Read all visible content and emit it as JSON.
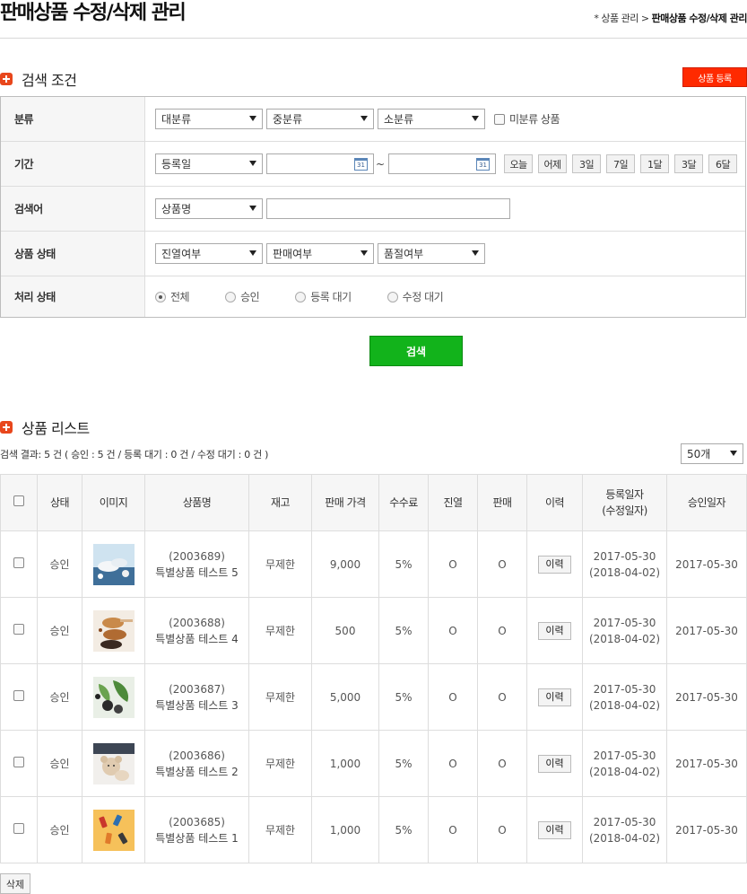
{
  "header": {
    "title": "판매상품 수정/삭제 관리",
    "breadcrumb_prefix": "* 상품 관리 >",
    "breadcrumb_current": "판매상품 수정/삭제 관리"
  },
  "search": {
    "section_title": "검색 조건",
    "register_button": "상품 등록",
    "category": {
      "label": "분류",
      "large": "대분류",
      "medium": "중분류",
      "small": "소분류",
      "uncategorized_label": "미분류 상품"
    },
    "period": {
      "label": "기간",
      "type": "등록일",
      "start_value": "",
      "end_value": "",
      "calendar_icon": "calendar-icon",
      "calendar_text": "31",
      "tilde": "~",
      "quick_buttons": [
        "오늘",
        "어제",
        "3일",
        "7일",
        "1달",
        "3달",
        "6달"
      ]
    },
    "keyword": {
      "label": "검색어",
      "type": "상품명",
      "value": ""
    },
    "product_status": {
      "label": "상품 상태",
      "display": "진열여부",
      "sale": "판매여부",
      "soldout": "품절여부"
    },
    "process_status": {
      "label": "처리 상태",
      "options": [
        "전체",
        "승인",
        "등록 대기",
        "수정 대기"
      ],
      "selected": "전체"
    },
    "search_button": "검색"
  },
  "list": {
    "section_title": "상품 리스트",
    "summary": "검색 결과: 5 건 ( 승인 : 5 건 / 등록 대기 : 0 건 / 수정 대기 : 0 건 )",
    "page_size": "50개",
    "headers": {
      "status": "상태",
      "image": "이미지",
      "name": "상품명",
      "stock": "재고",
      "price": "판매 가격",
      "fee": "수수료",
      "display": "진열",
      "sale": "판매",
      "history": "이력",
      "reg_date": "등록일자",
      "mod_date": "(수정일자)",
      "approve_date": "승인일자"
    },
    "rows": [
      {
        "status": "승인",
        "code": "(2003689)",
        "name": "특별상품 테스트 5",
        "stock": "무제한",
        "price": "9,000",
        "fee": "5%",
        "display": "O",
        "sale": "O",
        "history": "이력",
        "reg": "2017-05-30",
        "mod": "(2018-04-02)",
        "approve": "2017-05-30",
        "image": "towel-spa-thumbnail"
      },
      {
        "status": "승인",
        "code": "(2003688)",
        "name": "특별상품 테스트 4",
        "stock": "무제한",
        "price": "500",
        "fee": "5%",
        "display": "O",
        "sale": "O",
        "history": "이력",
        "reg": "2017-05-30",
        "mod": "(2018-04-02)",
        "approve": "2017-05-30",
        "image": "spice-spoon-thumbnail"
      },
      {
        "status": "승인",
        "code": "(2003687)",
        "name": "특별상품 테스트 3",
        "stock": "무제한",
        "price": "5,000",
        "fee": "5%",
        "display": "O",
        "sale": "O",
        "history": "이력",
        "reg": "2017-05-30",
        "mod": "(2018-04-02)",
        "approve": "2017-05-30",
        "image": "stones-leaf-thumbnail"
      },
      {
        "status": "승인",
        "code": "(2003686)",
        "name": "특별상품 테스트 2",
        "stock": "무제한",
        "price": "1,000",
        "fee": "5%",
        "display": "O",
        "sale": "O",
        "history": "이력",
        "reg": "2017-05-30",
        "mod": "(2018-04-02)",
        "approve": "2017-05-30",
        "image": "teddy-bear-thumbnail"
      },
      {
        "status": "승인",
        "code": "(2003685)",
        "name": "특별상품 테스트 1",
        "stock": "무제한",
        "price": "1,000",
        "fee": "5%",
        "display": "O",
        "sale": "O",
        "history": "이력",
        "reg": "2017-05-30",
        "mod": "(2018-04-02)",
        "approve": "2017-05-30",
        "image": "nail-polish-thumbnail"
      }
    ],
    "delete_button": "삭제"
  },
  "colors": {
    "accent_orange": "#e8471c",
    "register_red": "#ff2a00",
    "search_green": "#12b31b"
  }
}
